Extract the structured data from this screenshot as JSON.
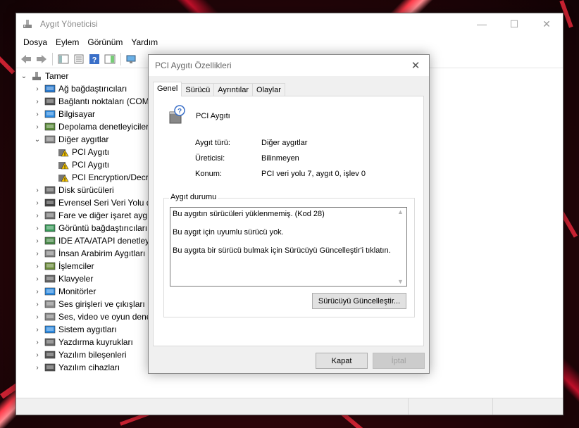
{
  "main_window": {
    "title": "Aygıt Yöneticisi",
    "controls": {
      "minimize": "—",
      "maximize": "☐",
      "close": "✕"
    }
  },
  "menu": [
    "Dosya",
    "Eylem",
    "Görünüm",
    "Yardım"
  ],
  "tree": {
    "root": "Tamer",
    "items": [
      {
        "label": "Ağ bağdaştırıcıları",
        "icon": "network-adapter-icon",
        "expanded": false
      },
      {
        "label": "Bağlantı noktaları (COM",
        "icon": "port-icon",
        "expanded": false
      },
      {
        "label": "Bilgisayar",
        "icon": "computer-icon",
        "expanded": false
      },
      {
        "label": "Depolama denetleyiciler",
        "icon": "storage-controller-icon",
        "expanded": false
      },
      {
        "label": "Diğer aygıtlar",
        "icon": "unknown-device-icon",
        "expanded": true,
        "children": [
          "PCI Aygıtı",
          "PCI Aygıtı",
          "PCI Encryption/Decr"
        ]
      },
      {
        "label": "Disk sürücüleri",
        "icon": "disk-drive-icon",
        "expanded": false
      },
      {
        "label": "Evrensel Seri Veri Yolu de",
        "icon": "usb-icon",
        "expanded": false
      },
      {
        "label": "Fare ve diğer işaret aygıt",
        "icon": "mouse-icon",
        "expanded": false
      },
      {
        "label": "Görüntü bağdaştırıcıları",
        "icon": "display-adapter-icon",
        "expanded": false
      },
      {
        "label": "IDE ATA/ATAPI denetleyi",
        "icon": "ide-controller-icon",
        "expanded": false
      },
      {
        "label": "İnsan Arabirim Aygıtları",
        "icon": "hid-icon",
        "expanded": false
      },
      {
        "label": "İşlemciler",
        "icon": "processor-icon",
        "expanded": false
      },
      {
        "label": "Klavyeler",
        "icon": "keyboard-icon",
        "expanded": false
      },
      {
        "label": "Monitörler",
        "icon": "monitor-icon",
        "expanded": false
      },
      {
        "label": "Ses girişleri ve çıkışları",
        "icon": "speaker-icon",
        "expanded": false
      },
      {
        "label": "Ses, video ve oyun dene",
        "icon": "sound-icon",
        "expanded": false
      },
      {
        "label": "Sistem aygıtları",
        "icon": "system-device-icon",
        "expanded": false
      },
      {
        "label": "Yazdırma kuyrukları",
        "icon": "printer-icon",
        "expanded": false
      },
      {
        "label": "Yazılım bileşenleri",
        "icon": "software-component-icon",
        "expanded": false
      },
      {
        "label": "Yazılım cihazları",
        "icon": "software-device-icon",
        "expanded": false
      }
    ]
  },
  "dialog": {
    "title": "PCI Aygıtı Özellikleri",
    "close": "✕",
    "tabs": [
      "Genel",
      "Sürücü",
      "Ayrıntılar",
      "Olaylar"
    ],
    "active_tab": "Genel",
    "device_name": "PCI Aygıtı",
    "properties": [
      {
        "label": "Aygıt türü:",
        "value": "Diğer aygıtlar"
      },
      {
        "label": "Üreticisi:",
        "value": "Bilinmeyen"
      },
      {
        "label": "Konum:",
        "value": "PCI veri yolu 7, aygıt 0, işlev 0"
      }
    ],
    "status_group_label": "Aygıt durumu",
    "status_lines": [
      "Bu aygıtın sürücüleri yüklenmemiş. (Kod 28)",
      "Bu aygıt için uyumlu sürücü yok.",
      "Bu aygıta bir sürücü bulmak için Sürücüyü Güncelleştir'i tıklatın."
    ],
    "update_driver_button": "Sürücüyü Güncelleştir...",
    "ok_button": "Kapat",
    "cancel_button": "İptal"
  },
  "colors": {
    "accent_red": "#e8283a",
    "dialog_bg": "#f0f0f0",
    "warning_yellow": "#f5c400"
  }
}
